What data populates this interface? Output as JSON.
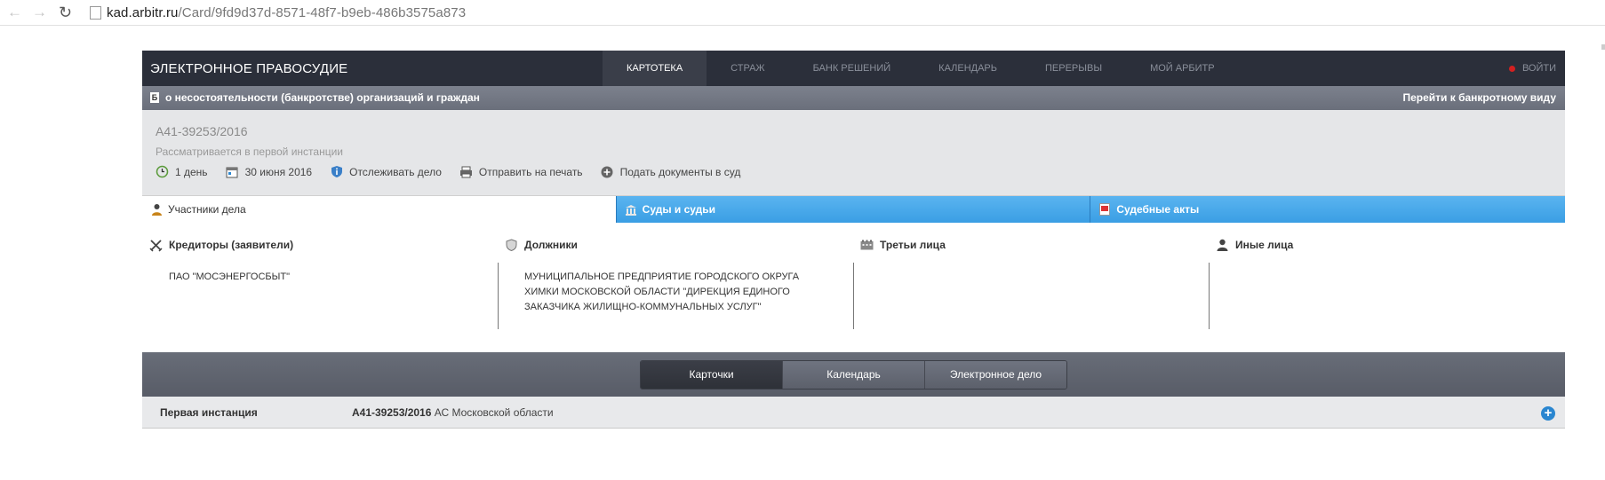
{
  "browser": {
    "url_domain": "kad.arbitr.ru",
    "url_path": "/Card/9fd9d37d-8571-48f7-b9eb-486b3575a873"
  },
  "header": {
    "logo": "ЭЛЕКТРОННОЕ ПРАВОСУДИЕ",
    "menu": [
      "КАРТОТЕКА",
      "СТРАЖ",
      "БАНК РЕШЕНИЙ",
      "КАЛЕНДАРЬ",
      "ПЕРЕРЫВЫ",
      "МОЙ АРБИТР"
    ],
    "active_menu": "КАРТОТЕКА",
    "login": "ВОЙТИ"
  },
  "subbar": {
    "icon_letter": "Б",
    "title": "о несостоятельности (банкротстве) организаций и граждан",
    "bank_view_link": "Перейти к банкротному виду"
  },
  "case": {
    "number": "А41-39253/2016",
    "status": "Рассматривается в первой инстанции",
    "actions": {
      "duration": "1 день",
      "date": "30 июня 2016",
      "track": "Отслеживать дело",
      "print": "Отправить на печать",
      "submit": "Подать документы в суд"
    }
  },
  "tabs": {
    "participants": "Участники дела",
    "courts": "Суды и судьи",
    "acts": "Судебные акты"
  },
  "participants": {
    "creditors": {
      "title": "Кредиторы (заявители)",
      "items": [
        "ПАО \"МОСЭНЕРГОСБЫТ\""
      ]
    },
    "debtors": {
      "title": "Должники",
      "items": [
        "МУНИЦИПАЛЬНОЕ ПРЕДПРИЯТИЕ ГОРОДСКОГО ОКРУГА ХИМКИ МОСКОВСКОЙ ОБЛАСТИ \"ДИРЕКЦИЯ ЕДИНОГО ЗАКАЗЧИКА ЖИЛИЩНО-КОММУНАЛЬНЫХ УСЛУГ\""
      ]
    },
    "third": {
      "title": "Третьи лица",
      "items": []
    },
    "other": {
      "title": "Иные лица",
      "items": []
    }
  },
  "switcher": {
    "cards": "Карточки",
    "calendar": "Календарь",
    "edelo": "Электронное дело",
    "active": "Карточки"
  },
  "instance": {
    "label": "Первая инстанция",
    "case_no": "А41-39253/2016",
    "court": "АС Московской области"
  },
  "colors": {
    "header_bg": "#2b2f3a",
    "tab_blue": "#3a9ee4",
    "plus_blue": "#2a86d0",
    "login_dot": "#d42020"
  }
}
